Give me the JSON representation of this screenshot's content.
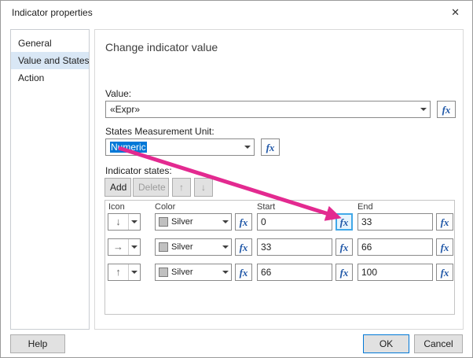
{
  "window": {
    "title": "Indicator properties",
    "close_glyph": "✕"
  },
  "sidebar": {
    "items": [
      {
        "label": "General"
      },
      {
        "label": "Value and States"
      },
      {
        "label": "Action"
      }
    ]
  },
  "main": {
    "heading": "Change indicator value",
    "value_field": {
      "label": "Value:",
      "value": "«Expr»"
    },
    "unit_field": {
      "label": "States Measurement Unit:",
      "value": "Numeric"
    },
    "states": {
      "label": "Indicator states:",
      "toolbar": {
        "add_label": "Add",
        "delete_label": "Delete",
        "up_glyph": "↑",
        "down_glyph": "↓"
      },
      "columns": {
        "icon": "Icon",
        "color": "Color",
        "start": "Start",
        "end": "End"
      },
      "rows": [
        {
          "icon_glyph": "↓",
          "color": "Silver",
          "start": "0",
          "end": "33"
        },
        {
          "icon_glyph": "→",
          "color": "Silver",
          "start": "33",
          "end": "66"
        },
        {
          "icon_glyph": "↑",
          "color": "Silver",
          "start": "66",
          "end": "100"
        }
      ]
    }
  },
  "footer": {
    "help_label": "Help",
    "ok_label": "OK",
    "cancel_label": "Cancel"
  },
  "icons": {
    "fx": "fx"
  },
  "colors": {
    "accent": "#0078d7",
    "annotation": "#e32a90",
    "fx": "#2158a8",
    "silver": "#c0c0c0"
  }
}
